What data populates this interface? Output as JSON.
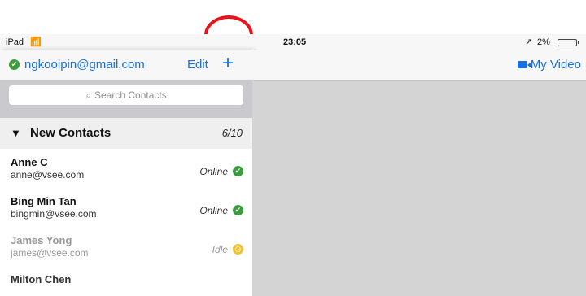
{
  "status_bar": {
    "device": "iPad",
    "time": "23:05",
    "battery": "2%"
  },
  "left_nav": {
    "account": "ngkooipin@gmail.com",
    "edit_label": "Edit",
    "add_label": "+"
  },
  "search": {
    "placeholder": "Search Contacts"
  },
  "section": {
    "title": "New Contacts",
    "count": "6/10"
  },
  "contacts": [
    {
      "name": "Anne C",
      "email": "anne@vsee.com",
      "status": "Online",
      "status_color": "#3a9c3a"
    },
    {
      "name": "Bing Min Tan",
      "email": "bingmin@vsee.com",
      "status": "Online",
      "status_color": "#3a9c3a"
    },
    {
      "name": "James Yong",
      "email": "james@vsee.com",
      "status": "Idle",
      "status_color": "#f0c330"
    },
    {
      "name": "Milton Chen",
      "email": "",
      "status": "",
      "status_color": ""
    }
  ],
  "right_nav": {
    "video_label": "My Video"
  },
  "colors": {
    "accent": "#1a6fe0",
    "online": "#3a9c3a",
    "idle": "#f0c330",
    "annotation": "#e8141a"
  },
  "icons": {
    "wifi": "wifi-icon",
    "location": "location-icon",
    "battery": "battery-icon",
    "online": "check-circle-icon",
    "idle": "clock-icon",
    "video": "video-camera-icon",
    "search": "search-icon",
    "add": "plus-icon",
    "collapse": "triangle-down-icon"
  }
}
